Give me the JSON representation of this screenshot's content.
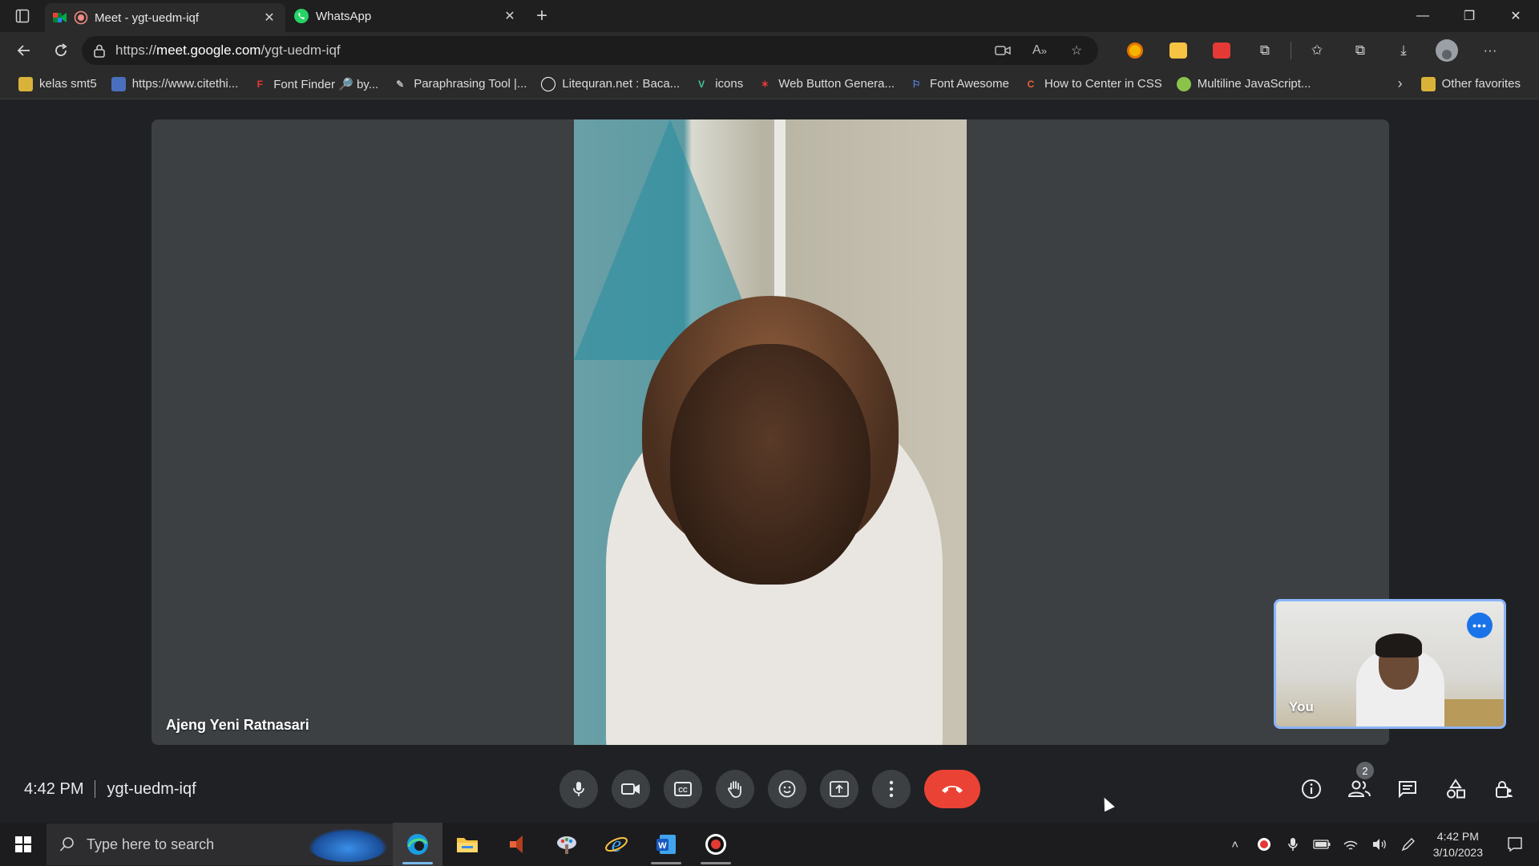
{
  "browser": {
    "tabs": [
      {
        "label": "Meet - ygt-uedm-iqf",
        "active": true
      },
      {
        "label": "WhatsApp",
        "active": false
      }
    ],
    "url_prefix": "https://",
    "url_host": "meet.google.com",
    "url_path": "/ygt-uedm-iqf",
    "favorites": [
      {
        "label": "kelas smt5",
        "icon": "folder-favicon",
        "color": "#d9b23a"
      },
      {
        "label": "https://www.citethi...",
        "icon": "citethis-favicon",
        "color": "#4a6fbf"
      },
      {
        "label": "Font Finder 🔎 by...",
        "icon": "fontfinder-favicon",
        "color": "#e53935"
      },
      {
        "label": "Paraphrasing Tool |...",
        "icon": "quill-favicon",
        "color": "#bdbdbd"
      },
      {
        "label": "Litequran.net : Baca...",
        "icon": "litequran-favicon",
        "color": "#ffffff"
      },
      {
        "label": "icons",
        "icon": "icons-favicon",
        "color": "#43c59e"
      },
      {
        "label": "Web Button Genera...",
        "icon": "star-favicon",
        "color": "#e53935"
      },
      {
        "label": "Font Awesome",
        "icon": "flag-favicon",
        "color": "#5b8def"
      },
      {
        "label": "How to Center in CSS",
        "icon": "css-favicon",
        "color": "#e8623a"
      },
      {
        "label": "Multiline JavaScript...",
        "icon": "js-favicon",
        "color": "#8bc34a"
      }
    ],
    "other_favorites": "Other favorites"
  },
  "meet": {
    "main_participant_name": "Ajeng Yeni Ratnasari",
    "self_label": "You",
    "time": "4:42 PM",
    "meeting_code": "ygt-uedm-iqf",
    "participants_count": "2",
    "colors": {
      "end_call": "#ea4335",
      "self_tile_border": "#8ab4f8",
      "accent": "#1a73e8"
    }
  },
  "taskbar": {
    "search_placeholder": "Type here to search",
    "clock_time": "4:42 PM",
    "clock_date": "3/10/2023"
  }
}
